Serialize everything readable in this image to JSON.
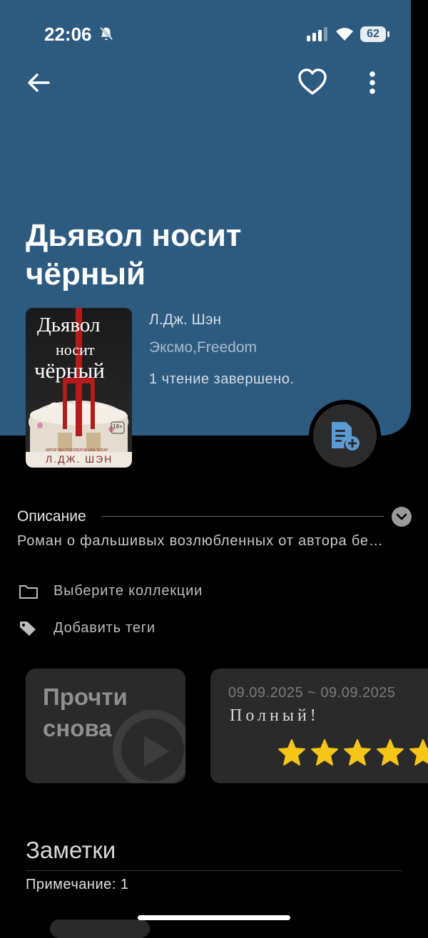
{
  "status_bar": {
    "time": "22:06",
    "battery": "62"
  },
  "book": {
    "title": "Дьявол носит чёрный",
    "author": "Л.Дж. Шэн",
    "publisher": "Эксмо,Freedom",
    "reads_status": "1 чтение завершено."
  },
  "cover": {
    "title_line1": "Дьявол",
    "title_line2": "носит",
    "title_line3": "чёрный",
    "age_badge": "18+",
    "tagline": "АВТОР БЕСТСЕЛЛЕРОВ USA TODAY",
    "author": "Л.ДЖ. ШЭН"
  },
  "description": {
    "label": "Описание",
    "text": "Роман о фальшивых возлюбленных от автора бе…"
  },
  "collections": {
    "label": "Выберите коллекции"
  },
  "tags": {
    "label": "Добавить теги"
  },
  "reread": {
    "label": "Прочти снова"
  },
  "reading_record": {
    "date_range": "09.09.2025 ~ 09.09.2025",
    "status": "Полный!",
    "rating": 5
  },
  "notes": {
    "title": "Заметки",
    "count_label": "Примечание: 1"
  },
  "colors": {
    "header_bg": "#2d5a7f",
    "star": "#f5c518",
    "fab_icon": "#5b9bd5"
  }
}
